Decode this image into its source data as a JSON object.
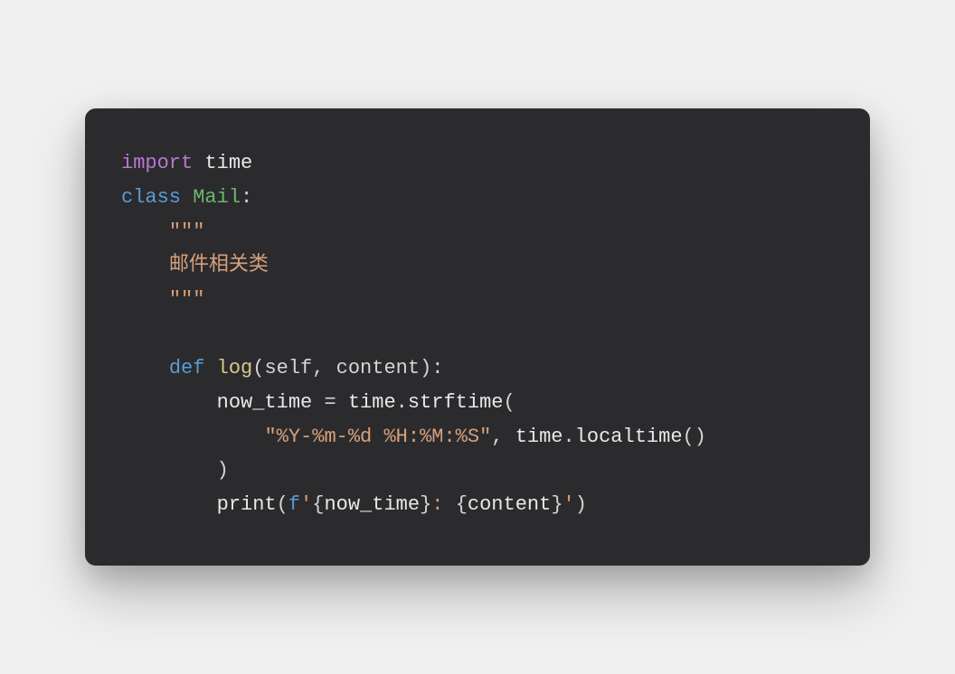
{
  "code": {
    "line1": {
      "import": "import",
      "module": " time"
    },
    "line2": {
      "class": "class",
      "name": " Mail",
      "colon": ":"
    },
    "line3": {
      "indent": "    ",
      "docq": "\"\"\""
    },
    "line4": {
      "indent": "    ",
      "doc": "邮件相关类"
    },
    "line5": {
      "indent": "    ",
      "docq": "\"\"\""
    },
    "line6": {
      "blank": ""
    },
    "line7": {
      "indent": "    ",
      "def": "def",
      "name": " log",
      "paren_o": "(",
      "self": "self",
      "comma": ", ",
      "param": "content",
      "paren_c": ")",
      "colon": ":"
    },
    "line8": {
      "indent": "        ",
      "var": "now_time ",
      "eq": "=",
      "time": " time",
      "dot": ".",
      "fn": "strftime",
      "paren": "("
    },
    "line9": {
      "indent": "            ",
      "fmt": "\"%Y-%m-%d %H:%M:%S\"",
      "comma": ", ",
      "time": "time",
      "dot": ".",
      "fn": "localtime",
      "parens": "()"
    },
    "line10": {
      "indent": "        ",
      "paren": ")"
    },
    "line11": {
      "indent": "        ",
      "print": "print",
      "paren_o": "(",
      "fprefix": "f",
      "q1": "'",
      "brace1o": "{",
      "var1": "now_time",
      "brace1c": "}",
      "colon_str": ": ",
      "brace2o": "{",
      "var2": "content",
      "brace2c": "}",
      "q2": "'",
      "paren_c": ")"
    }
  }
}
